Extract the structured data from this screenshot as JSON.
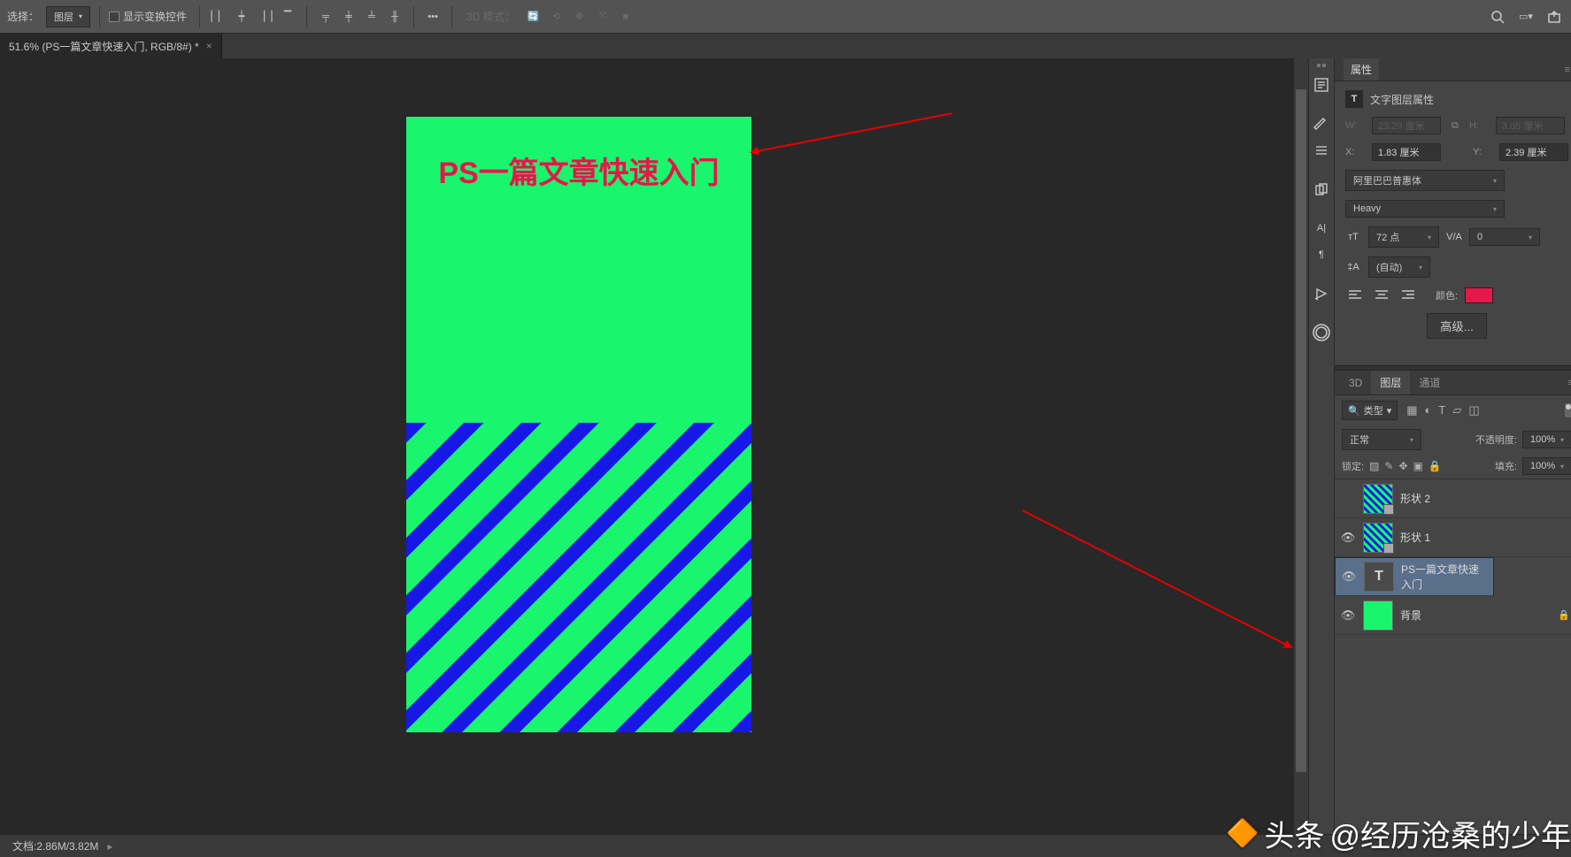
{
  "options": {
    "select_label": "选择：",
    "layer_dropdown": "图层",
    "show_transform": "显示变换控件",
    "mode3d_label": "3D 模式："
  },
  "tab": {
    "title": "51.6% (PS一篇文章快速入门, RGB/8#) *"
  },
  "canvas": {
    "text": "PS一篇文章快速入门"
  },
  "properties": {
    "panel_title": "属性",
    "section_title": "文字图层属性",
    "w_label": "W:",
    "w_value": "23.29 厘米",
    "h_label": "H:",
    "h_value": "3.05 厘米",
    "x_label": "X:",
    "x_value": "1.83 厘米",
    "y_label": "Y:",
    "y_value": "2.39 厘米",
    "font_family": "阿里巴巴普惠体",
    "font_weight": "Heavy",
    "font_size": "72 点",
    "tracking": "0",
    "leading": "(自动)",
    "color_label": "颜色:",
    "color_value": "#e6174a",
    "advanced_btn": "高级..."
  },
  "layers_panel": {
    "tab_3d": "3D",
    "tab_layers": "图层",
    "tab_channels": "通道",
    "filter_type": "类型",
    "blend_mode": "正常",
    "opacity_label": "不透明度:",
    "opacity_value": "100%",
    "lock_label": "锁定:",
    "fill_label": "填充:",
    "fill_value": "100%",
    "layers": [
      {
        "name": "形状 2",
        "visible": false,
        "type": "shape-stripes"
      },
      {
        "name": "形状 1",
        "visible": true,
        "type": "shape-stripes"
      },
      {
        "name": "PS一篇文章快速入门",
        "visible": true,
        "type": "text",
        "selected": true
      },
      {
        "name": "背景",
        "visible": true,
        "type": "bg",
        "locked": true
      }
    ]
  },
  "status": {
    "doc_label": "文档:",
    "doc_size": "2.86M/3.82M"
  },
  "watermark": {
    "brand": "头条",
    "author": "@经历沧桑的少年"
  }
}
